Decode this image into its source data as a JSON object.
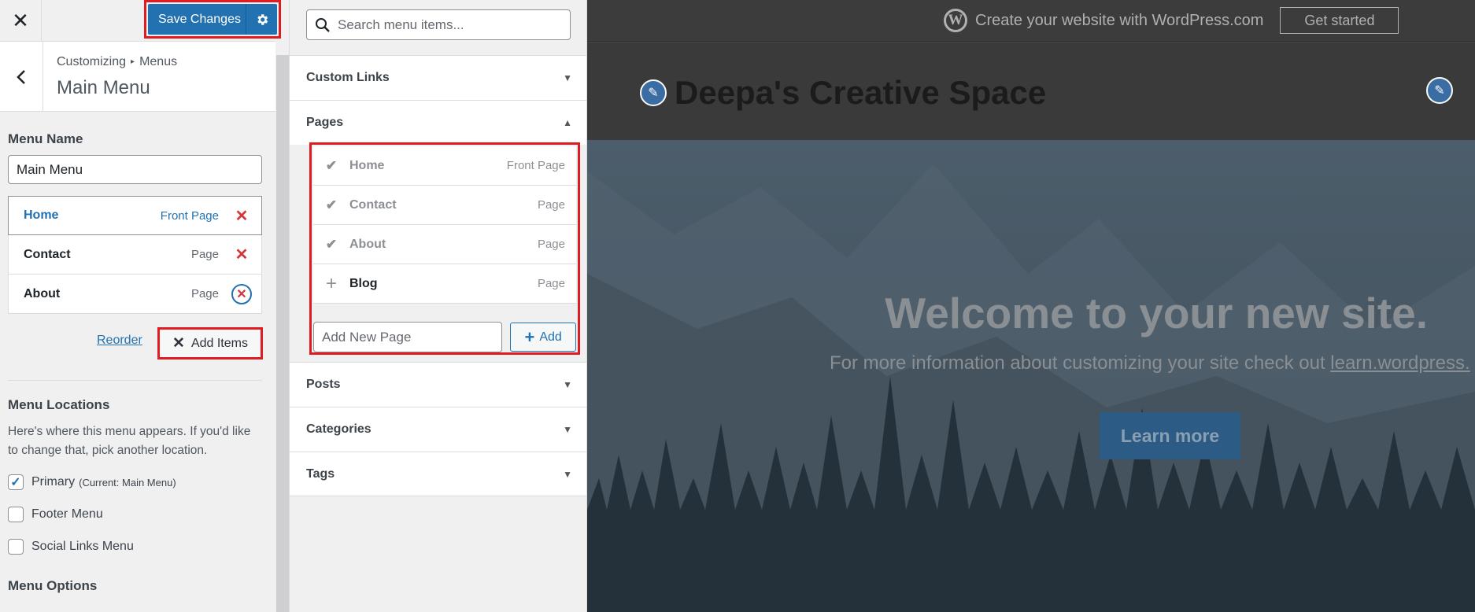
{
  "customizer": {
    "close_icon": "close-icon",
    "save_label": "Save Changes",
    "breadcrumb": {
      "part1": "Customizing",
      "sep": "▸",
      "part2": "Menus"
    },
    "section_title": "Main Menu",
    "menu_name_label": "Menu Name",
    "menu_name_value": "Main Menu",
    "menu_items": [
      {
        "title": "Home",
        "type": "Front Page"
      },
      {
        "title": "Contact",
        "type": "Page"
      },
      {
        "title": "About",
        "type": "Page"
      }
    ],
    "reorder_label": "Reorder",
    "add_items_label": "Add Items",
    "locations_title": "Menu Locations",
    "locations_desc": "Here's where this menu appears. If you'd like to change that, pick another location.",
    "locations": [
      {
        "label": "Primary",
        "note": "(Current: Main Menu)",
        "checked": true
      },
      {
        "label": "Footer Menu",
        "note": "",
        "checked": false
      },
      {
        "label": "Social Links Menu",
        "note": "",
        "checked": false
      }
    ],
    "options_title": "Menu Options"
  },
  "available": {
    "search_placeholder": "Search menu items...",
    "sections": {
      "custom_links": "Custom Links",
      "pages": "Pages",
      "posts": "Posts",
      "categories": "Categories",
      "tags": "Tags"
    },
    "pages": [
      {
        "title": "Home",
        "type": "Front Page",
        "added": true
      },
      {
        "title": "Contact",
        "type": "Page",
        "added": true
      },
      {
        "title": "About",
        "type": "Page",
        "added": true
      },
      {
        "title": "Blog",
        "type": "Page",
        "added": false
      }
    ],
    "new_page_placeholder": "Add New Page",
    "add_label": "Add"
  },
  "preview": {
    "wpbar_text": "Create your website with WordPress.com",
    "get_started": "Get started",
    "site_title": "Deepa's Creative Space",
    "hero_title": "Welcome to your new site.",
    "hero_sub_prefix": "For more information about customizing your site check out ",
    "hero_sub_link": "learn.wordpress.",
    "learn_more": "Learn more"
  },
  "colors": {
    "accent": "#2271b1",
    "highlight_border": "#e11b22",
    "delete": "#d63638"
  }
}
